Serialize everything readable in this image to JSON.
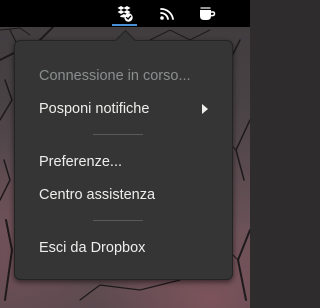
{
  "top_bar": {
    "tray_icons": [
      "dropbox-icon",
      "wifi-icon",
      "coffee-cup-icon"
    ],
    "active_indicator_color": "#4a90d9"
  },
  "dropbox_menu": {
    "status": "Connessione in corso...",
    "snooze_notifications": "Posponi notifiche",
    "preferences": "Preferenze...",
    "help_center": "Centro assistenza",
    "quit": "Esci da Dropbox"
  },
  "colors": {
    "menu_background": "#353535",
    "menu_text": "#eeeeec",
    "disabled_text": "#8b8e8f",
    "top_bar": "#000000"
  }
}
